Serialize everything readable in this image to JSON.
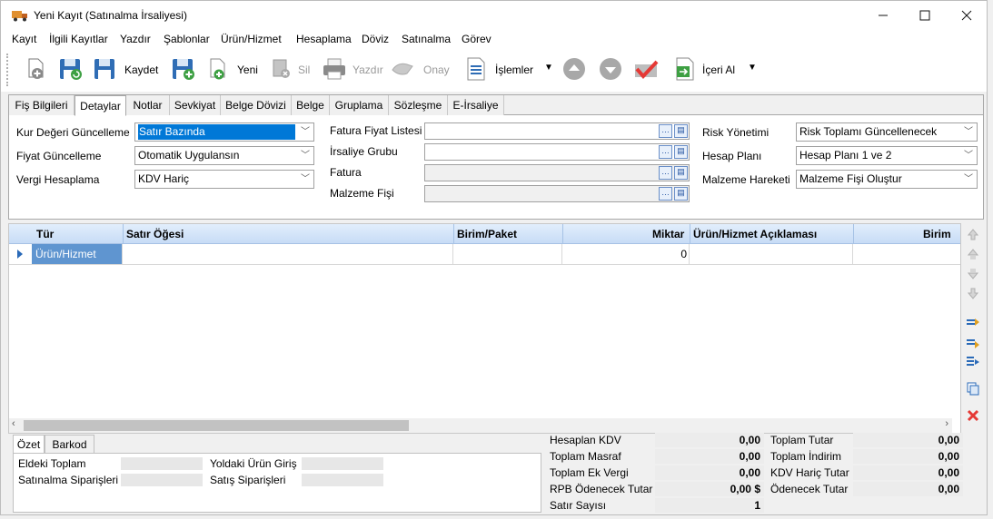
{
  "window": {
    "title": "Yeni Kayıt (Satınalma İrsaliyesi)",
    "icon": "truck-icon"
  },
  "menu": [
    "Kayıt",
    "İlgili Kayıtlar",
    "Yazdır",
    "Şablonlar",
    "Ürün/Hizmet",
    "Hesaplama",
    "Döviz",
    "Satınalma",
    "Görev"
  ],
  "toolbar": {
    "save_label": "Kaydet",
    "new_label": "Yeni",
    "delete_label": "Sil",
    "print_label": "Yazdır",
    "approve_label": "Onay",
    "operations_label": "İşlemler",
    "import_label": "İçeri Al"
  },
  "tabs": [
    "Fiş Bilgileri",
    "Detaylar",
    "Notlar",
    "Sevkiyat",
    "Belge Dövizi",
    "Belge",
    "Gruplama",
    "Sözleşme",
    "E-İrsaliye"
  ],
  "active_tab": "Detaylar",
  "details": {
    "kur_label": "Kur Değeri Güncelleme",
    "kur_value": "Satır Bazında",
    "fiyat_label": "Fiyat Güncelleme",
    "fiyat_value": "Otomatik Uygulansın",
    "vergi_label": "Vergi Hesaplama",
    "vergi_value": "KDV Hariç",
    "fatura_fiyat_label": "Fatura Fiyat Listesi",
    "irsaliye_grubu_label": "İrsaliye Grubu",
    "fatura_label": "Fatura",
    "malzeme_fisi_label": "Malzeme Fişi",
    "risk_label": "Risk Yönetimi",
    "risk_value": "Risk Toplamı Güncellenecek",
    "hesap_label": "Hesap Planı",
    "hesap_value": "Hesap Planı 1 ve 2",
    "malzeme_hareketi_label": "Malzeme Hareketi",
    "malzeme_hareketi_value": "Malzeme Fişi Oluştur"
  },
  "grid": {
    "headers": {
      "tur": "Tür",
      "satir": "Satır Öğesi",
      "birim_paket": "Birim/Paket",
      "miktar": "Miktar",
      "aciklama": "Ürün/Hizmet Açıklaması",
      "birim": "Birim"
    },
    "row": {
      "tur": "Ürün/Hizmet",
      "miktar": "0"
    }
  },
  "bottom_tabs": [
    "Özet",
    "Barkod"
  ],
  "summary": {
    "eldeki_toplam": "Eldeki Toplam",
    "yoldaki_urun": "Yoldaki Ürün Giriş",
    "satinalma_siparisleri": "Satınalma Siparişleri",
    "satis_siparisleri": "Satış Siparişleri"
  },
  "totals": {
    "hesaplan_kdv_label": "Hesaplan KDV",
    "hesaplan_kdv": "0,00",
    "toplam_masraf_label": "Toplam Masraf",
    "toplam_masraf": "0,00",
    "toplam_ek_vergi_label": "Toplam Ek Vergi",
    "toplam_ek_vergi": "0,00",
    "rpb_label": "RPB Ödenecek Tutar",
    "rpb": "0,00 $",
    "satir_sayisi_label": "Satır Sayısı",
    "satir_sayisi": "1",
    "toplam_tutar_label": "Toplam Tutar",
    "toplam_tutar": "0,00",
    "toplam_indirim_label": "Toplam İndirim",
    "toplam_indirim": "0,00",
    "kdv_haric_label": "KDV Hariç Tutar",
    "kdv_haric": "0,00",
    "odenecek_label": "Ödenecek Tutar",
    "odenecek": "0,00"
  },
  "colors": {
    "selection": "#0078d7",
    "grid_header": "#c7dcf6",
    "row_selected": "#5f95d0",
    "delete_red": "#e53935"
  }
}
